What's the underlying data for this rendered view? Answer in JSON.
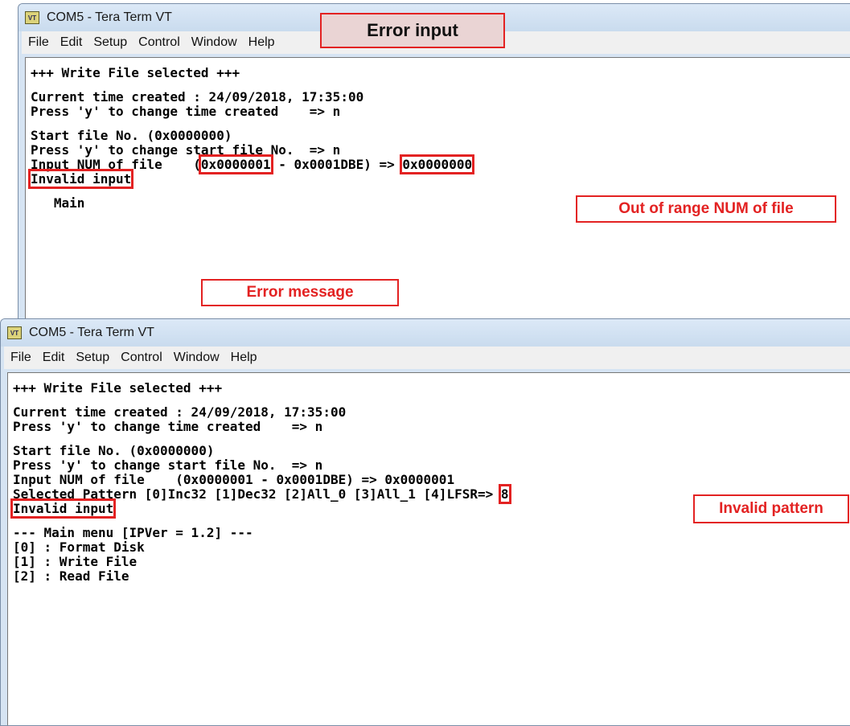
{
  "window1": {
    "title": "COM5 - Tera Term VT",
    "icon": "VT",
    "menu": [
      "File",
      "Edit",
      "Setup",
      "Control",
      "Window",
      "Help"
    ],
    "lines": {
      "l1": "+++ Write File selected +++",
      "l2": "Current time created : 24/09/2018, 17:35:00",
      "l3": "Press 'y' to change time created    => n",
      "l4": "Start file No. (0x0000000)",
      "l5": "Press 'y' to change start file No.  => n",
      "l6a": "Input NUM of file    (",
      "l6b": "0x0000001",
      "l6c": " - 0x0001DBE) => ",
      "l6d": "0x0000000",
      "l7": "Invalid input",
      "l8": "   Main"
    }
  },
  "window2": {
    "title": "COM5 - Tera Term VT",
    "icon": "VT",
    "menu": [
      "File",
      "Edit",
      "Setup",
      "Control",
      "Window",
      "Help"
    ],
    "lines": {
      "l1": "+++ Write File selected +++",
      "l2": "Current time created : 24/09/2018, 17:35:00",
      "l3": "Press 'y' to change time created    => n",
      "l4": "Start file No. (0x0000000)",
      "l5": "Press 'y' to change start file No.  => n",
      "l6": "Input NUM of file    (0x0000001 - 0x0001DBE) => 0x0000001",
      "l7a": "Selected Pattern [0]Inc32 [1]Dec32 [2]All_0 [3]All_1 [4]LFSR=> ",
      "l7b": "8",
      "l8": "Invalid input",
      "l9": "--- Main menu [IPVer = 1.2] ---",
      "l10": "[0] : Format Disk",
      "l11": "[1] : Write File",
      "l12": "[2] : Read File"
    }
  },
  "callouts": {
    "title": "Error input",
    "range": "Out of range NUM of file",
    "message": "Error message",
    "pattern": "Invalid pattern"
  },
  "colors": {
    "accent": "#e32222",
    "title_bg": "#ead4d4"
  }
}
